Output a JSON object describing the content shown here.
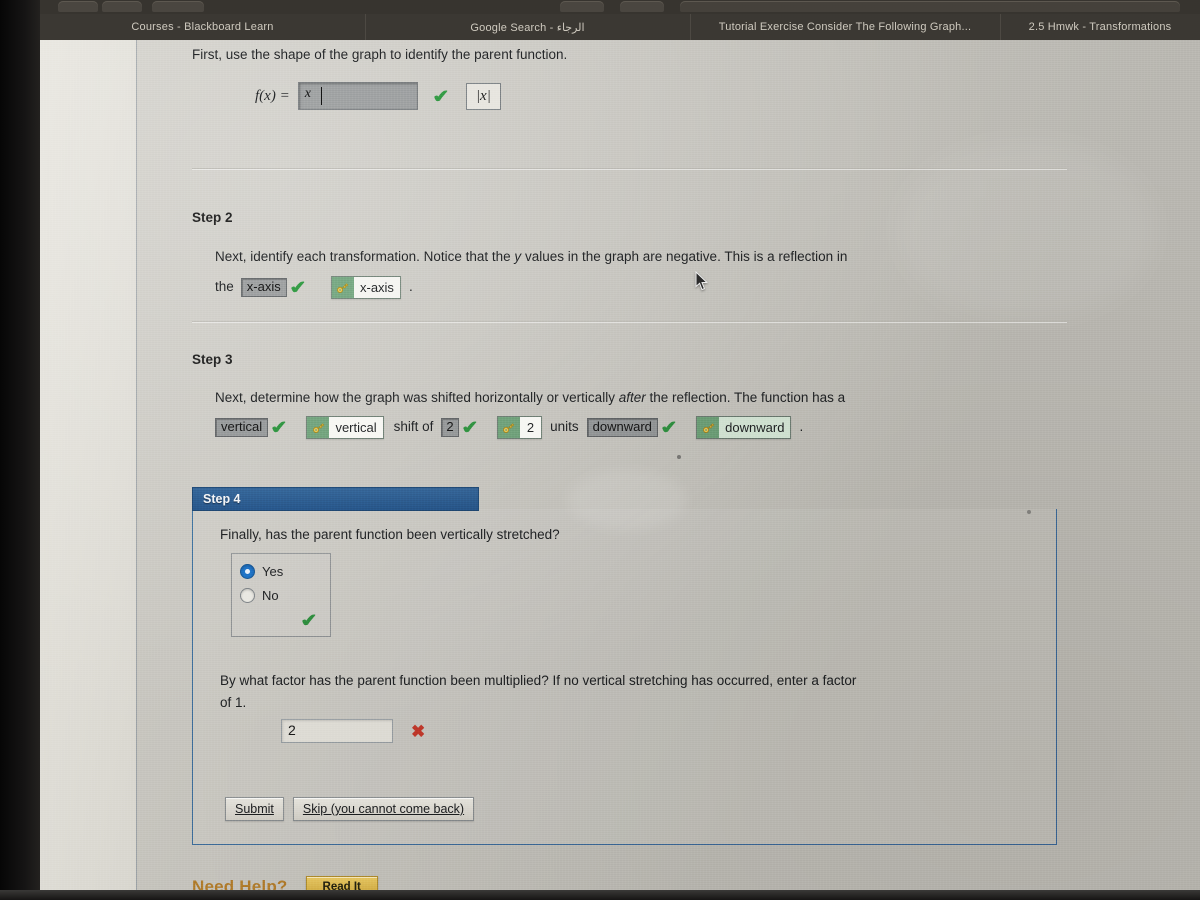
{
  "browser": {
    "tabs": [
      {
        "label": "Courses - Blackboard Learn"
      },
      {
        "label": "Google Search - الرجاء"
      },
      {
        "label": "Tutorial Exercise Consider The Following Graph..."
      },
      {
        "label": "2.5 Hmwk - Transformations"
      }
    ]
  },
  "step1": {
    "prompt": "First, use the shape of the graph to identify the parent function.",
    "fx_label": "f(x)  =",
    "answer_value": "|x|",
    "answer_display": "x",
    "status_icon": "check-icon",
    "preview": "|x|"
  },
  "step2": {
    "title": "Step 2",
    "text_before": "Next, identify each transformation. Notice that the",
    "text_italic_y": "y",
    "text_after": "values in the graph are negative. This is a reflection in",
    "line2_lead": "the",
    "answer_chip": "x-axis",
    "status_icon": "check-icon",
    "key_answer": "x-axis",
    "trailing_period": "."
  },
  "step3": {
    "title": "Step 3",
    "text_1": "Next, determine how the graph was shifted horizontally or vertically",
    "text_italic": "after",
    "text_2": "the reflection. The function has a",
    "chip_direction": "vertical",
    "key_direction": "vertical",
    "mid_text": "shift of",
    "chip_units": "2",
    "key_units": "2",
    "units_word": "units",
    "chip_down": "downward",
    "key_down": "downward",
    "trailing_period": "."
  },
  "step4": {
    "header": "Step 4",
    "question": "Finally, has the parent function been vertically stretched?",
    "options": [
      {
        "label": "Yes",
        "selected": true
      },
      {
        "label": "No",
        "selected": false
      }
    ],
    "radio_status_icon": "check-icon",
    "factor_question_line1": "By what factor has the parent function been multiplied? If no vertical stretching has occurred, enter a factor",
    "factor_question_line2": "of 1.",
    "factor_value": "2",
    "factor_status_icon": "x-icon",
    "submit_label": "Submit",
    "skip_label": "Skip (you cannot come back)"
  },
  "footer": {
    "need_help_label": "Need Help?",
    "read_it_label": "Read It"
  },
  "colors": {
    "step_header_blue": "#2b5480",
    "correct_green": "#2e8b3d",
    "incorrect_red": "#c0392b",
    "need_help_gold": "#b07c2b",
    "read_it_button": "#c9a43b",
    "radio_selected_blue": "#1f6fc4",
    "answer_chip_gray": "#8e9192",
    "key_icon_green": "#6a9b74"
  }
}
